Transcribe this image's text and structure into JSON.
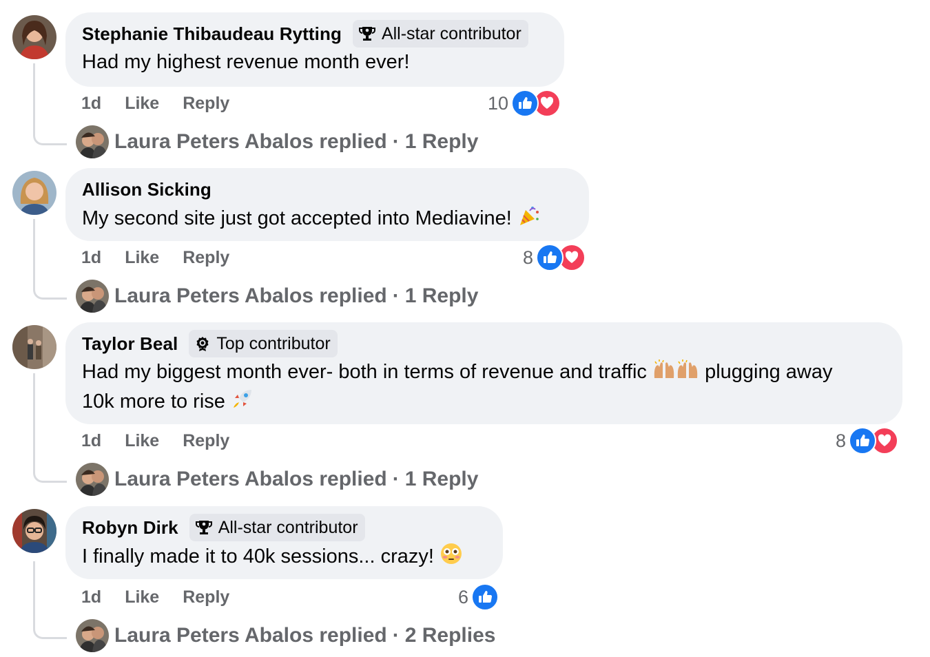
{
  "comments": [
    {
      "author": "Stephanie Thibaudeau Rytting",
      "badge": {
        "icon": "trophy-icon",
        "label": "All-star contributor"
      },
      "text": "Had my highest revenue month ever!",
      "text2": "",
      "emoji": [],
      "time": "1d",
      "like_label": "Like",
      "reply_label": "Reply",
      "reaction_count": "10",
      "reactions": [
        "like",
        "love"
      ],
      "reply_summary": {
        "name": "Laura Peters Abalos replied",
        "sep": "·",
        "count": "1 Reply"
      }
    },
    {
      "author": "Allison Sicking",
      "badge": null,
      "text": "My second site just got accepted into Mediavine!",
      "text2": "",
      "emoji": [
        "party-popper"
      ],
      "time": "1d",
      "like_label": "Like",
      "reply_label": "Reply",
      "reaction_count": "8",
      "reactions": [
        "like",
        "love"
      ],
      "reply_summary": {
        "name": "Laura Peters Abalos replied",
        "sep": "·",
        "count": "1 Reply"
      }
    },
    {
      "author": "Taylor Beal",
      "badge": {
        "icon": "top-contributor-icon",
        "label": "Top contributor"
      },
      "text": "Had my biggest month ever- both in terms of revenue and traffic",
      "text_after_emoji": "plugging away",
      "text2": "10k more to rise",
      "emoji": [
        "raising-hands",
        "raising-hands",
        "rocket"
      ],
      "time": "1d",
      "like_label": "Like",
      "reply_label": "Reply",
      "reaction_count": "8",
      "reactions": [
        "like",
        "love"
      ],
      "reply_summary": {
        "name": "Laura Peters Abalos replied",
        "sep": "·",
        "count": "1 Reply"
      }
    },
    {
      "author": "Robyn Dirk",
      "badge": {
        "icon": "trophy-icon",
        "label": "All-star contributor"
      },
      "text": "I finally made it to 40k sessions... crazy!",
      "text2": "",
      "emoji": [
        "flushed-face"
      ],
      "time": "1d",
      "like_label": "Like",
      "reply_label": "Reply",
      "reaction_count": "6",
      "reactions": [
        "like"
      ],
      "reply_summary": {
        "name": "Laura Peters Abalos replied",
        "sep": "·",
        "count": "2 Replies"
      }
    }
  ],
  "colors": {
    "bubble": "#f0f2f5",
    "badge": "#e4e6eb",
    "secondary_text": "#65676b",
    "like_blue": "#1877f2",
    "love_red": "#f33e58"
  }
}
